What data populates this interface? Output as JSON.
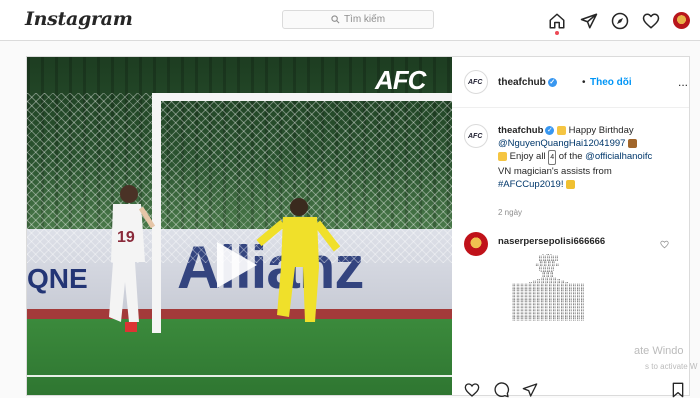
{
  "header": {
    "logo": "Instagram",
    "search_placeholder": "Tìm kiếm",
    "icons": [
      "home-icon",
      "direct-icon",
      "explore-icon",
      "heart-icon",
      "avatar"
    ]
  },
  "post": {
    "video": {
      "watermark": "AFC",
      "banner_text": "Allianz",
      "banner_left": "QNE",
      "player_number": "19"
    },
    "author": {
      "username": "theafchub",
      "follow_label": "Theo dõi",
      "more": "..."
    },
    "caption": {
      "username": "theafchub",
      "greeting": "Happy Birthday",
      "mention": "@NguyenQuangHai12041997",
      "line2_pre": "Enjoy all",
      "count": "4",
      "line2_mid": "of the",
      "mention2": "@officialhanoifc",
      "line3": "VN magician's assists from",
      "hashtag": "#AFCCup2019!"
    },
    "timestamp": "2 ngày",
    "comment": {
      "username": "naserpersepolisi666666"
    },
    "overlay": {
      "line1": "ate Windo",
      "line2": "s to activate W"
    }
  },
  "colors": {
    "link": "#00376b",
    "follow": "#0095f6",
    "accent": "#ed4956"
  }
}
